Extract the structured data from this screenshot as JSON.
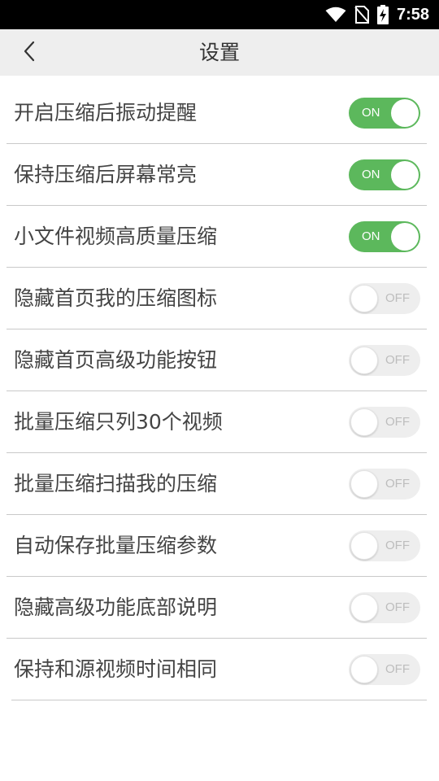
{
  "status_bar": {
    "time": "7:58",
    "icons": [
      "wifi-icon",
      "no-sim-icon",
      "battery-charging-icon"
    ]
  },
  "header": {
    "title": "设置",
    "back_icon": "chevron-left-icon"
  },
  "colors": {
    "toggle_on": "#5cb85c",
    "toggle_off": "#eeeeee",
    "header_bg": "#eeeeee"
  },
  "settings": [
    {
      "label": "开启压缩后振动提醒",
      "state": "ON",
      "on": true
    },
    {
      "label": "保持压缩后屏幕常亮",
      "state": "ON",
      "on": true
    },
    {
      "label": "小文件视频高质量压缩",
      "state": "ON",
      "on": true
    },
    {
      "label": "隐藏首页我的压缩图标",
      "state": "OFF",
      "on": false
    },
    {
      "label": "隐藏首页高级功能按钮",
      "state": "OFF",
      "on": false
    },
    {
      "label": "批量压缩只列30个视频",
      "state": "OFF",
      "on": false
    },
    {
      "label": "批量压缩扫描我的压缩",
      "state": "OFF",
      "on": false
    },
    {
      "label": "自动保存批量压缩参数",
      "state": "OFF",
      "on": false
    },
    {
      "label": "隐藏高级功能底部说明",
      "state": "OFF",
      "on": false
    },
    {
      "label": "保持和源视频时间相同",
      "state": "OFF",
      "on": false
    }
  ]
}
